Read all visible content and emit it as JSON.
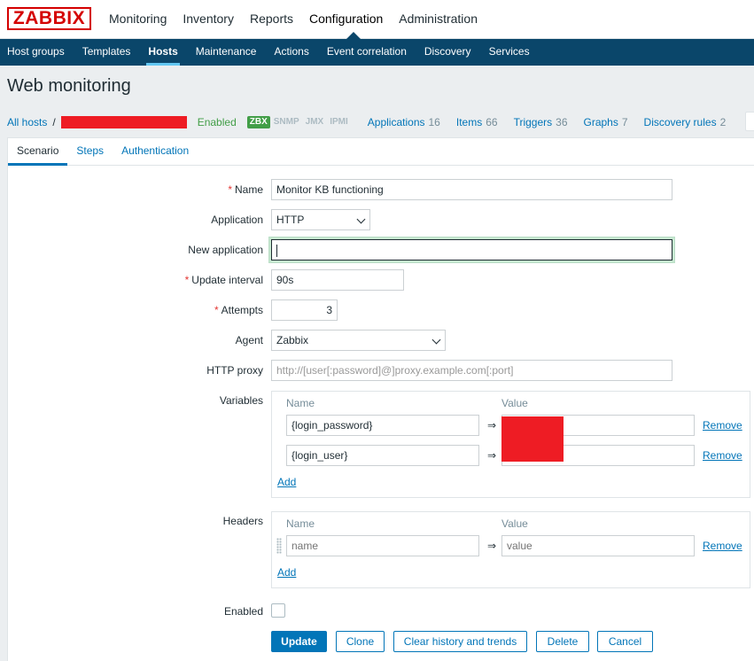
{
  "logo": "ZABBIX",
  "top_nav": [
    "Monitoring",
    "Inventory",
    "Reports",
    "Configuration",
    "Administration"
  ],
  "sub_nav": [
    "Host groups",
    "Templates",
    "Hosts",
    "Maintenance",
    "Actions",
    "Event correlation",
    "Discovery",
    "Services"
  ],
  "page_title": "Web monitoring",
  "host_nav": {
    "all_hosts": "All hosts",
    "separator": "/",
    "status": "Enabled",
    "availability": [
      "ZBX",
      "SNMP",
      "JMX",
      "IPMI"
    ],
    "links": [
      {
        "label": "Applications",
        "count": "16"
      },
      {
        "label": "Items",
        "count": "66"
      },
      {
        "label": "Triggers",
        "count": "36"
      },
      {
        "label": "Graphs",
        "count": "7"
      },
      {
        "label": "Discovery rules",
        "count": "2"
      }
    ]
  },
  "tabs": [
    "Scenario",
    "Steps",
    "Authentication"
  ],
  "form": {
    "name_label": "Name",
    "name_value": "Monitor KB functioning",
    "application_label": "Application",
    "application_value": "HTTP",
    "new_application_label": "New application",
    "new_application_value": "",
    "update_interval_label": "Update interval",
    "update_interval_value": "90s",
    "attempts_label": "Attempts",
    "attempts_value": "3",
    "agent_label": "Agent",
    "agent_value": "Zabbix",
    "http_proxy_label": "HTTP proxy",
    "http_proxy_placeholder": "http://[user[:password]@]proxy.example.com[:port]",
    "variables_label": "Variables",
    "headers_label": "Headers",
    "enabled_label": "Enabled",
    "required_mark": "*"
  },
  "table": {
    "col_name": "Name",
    "col_value": "Value",
    "arrow": "⇒",
    "remove": "Remove",
    "add": "Add"
  },
  "variables": [
    {
      "name": "{login_password}",
      "value": ""
    },
    {
      "name": "{login_user}",
      "value": ""
    }
  ],
  "headers": [
    {
      "name_placeholder": "name",
      "value_placeholder": "value"
    }
  ],
  "buttons": {
    "update": "Update",
    "clone": "Clone",
    "clear": "Clear history and trends",
    "delete": "Delete",
    "cancel": "Cancel"
  },
  "colors": {
    "brand": "#d40000",
    "nav_bg": "#0a466a",
    "link": "#0275b8",
    "enabled": "#429e47",
    "redaction": "#ee1c24"
  }
}
